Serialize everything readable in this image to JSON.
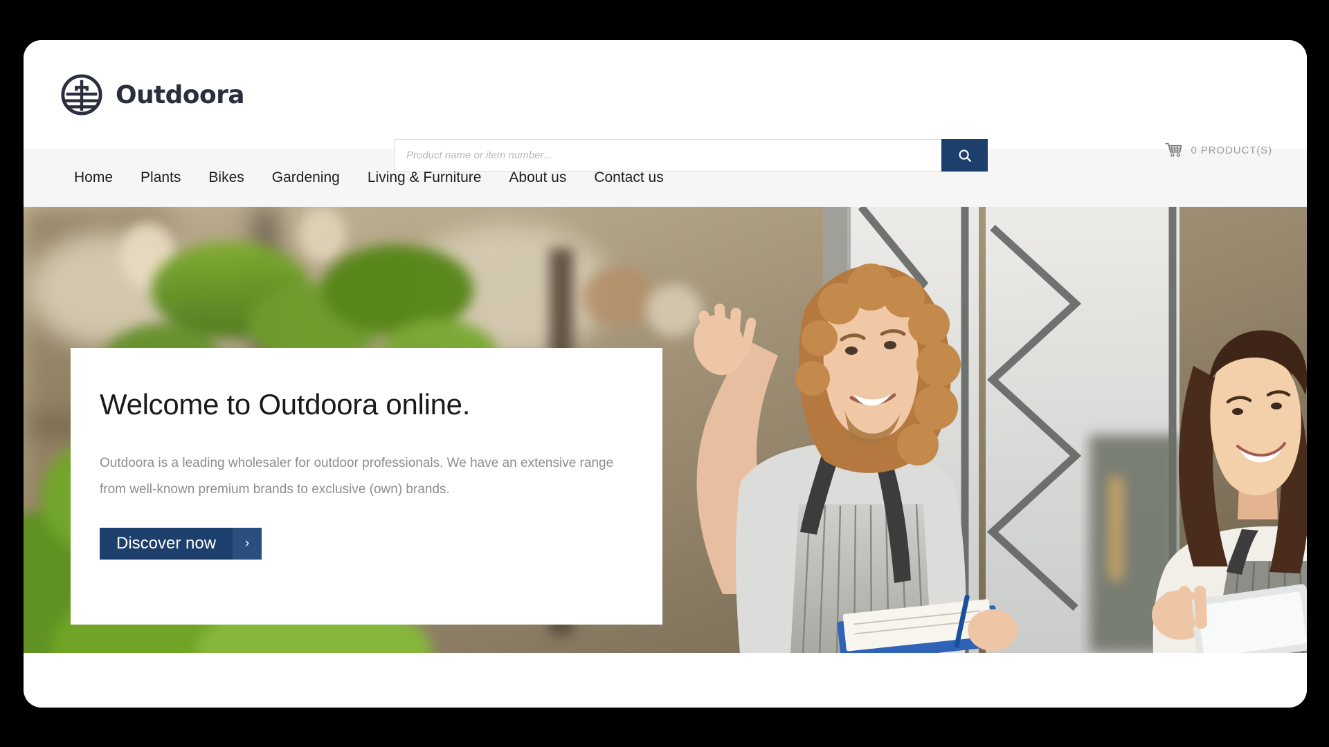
{
  "brand": {
    "name": "Outdoora",
    "logo_icon": "outdoora-circle-tree-logo",
    "logo_color": "#2b2e3d"
  },
  "search": {
    "placeholder": "Product name or item number...",
    "value": "",
    "button_icon": "search-icon",
    "button_color": "#1d3f6b"
  },
  "cart": {
    "icon": "shopping-cart-icon",
    "label": "0 PRODUCT(S)",
    "count": 0
  },
  "nav": {
    "items": [
      {
        "label": "Home"
      },
      {
        "label": "Plants"
      },
      {
        "label": "Bikes"
      },
      {
        "label": "Gardening"
      },
      {
        "label": "Living & Furniture"
      },
      {
        "label": "About us"
      },
      {
        "label": "Contact us"
      }
    ]
  },
  "hero": {
    "title": "Welcome to Outdoora online.",
    "text": "Outdoora is a leading wholesaler for outdoor professionals. We have an extensive range from well-known premium brands to exclusive (own) brands.",
    "cta_label": "Discover now",
    "cta_arrow": "›",
    "cta_color": "#1d3f6b",
    "image_alt": "Two garden-centre employees in striped aprons looking up among plants and shelving"
  },
  "colors": {
    "accent_navy": "#1d3f6b",
    "accent_navy_light": "#2a4e7d",
    "nav_background": "#f6f6f6",
    "body_text": "#8d8d8d",
    "heading_text": "#1a1a1a",
    "page_background": "#000000"
  }
}
